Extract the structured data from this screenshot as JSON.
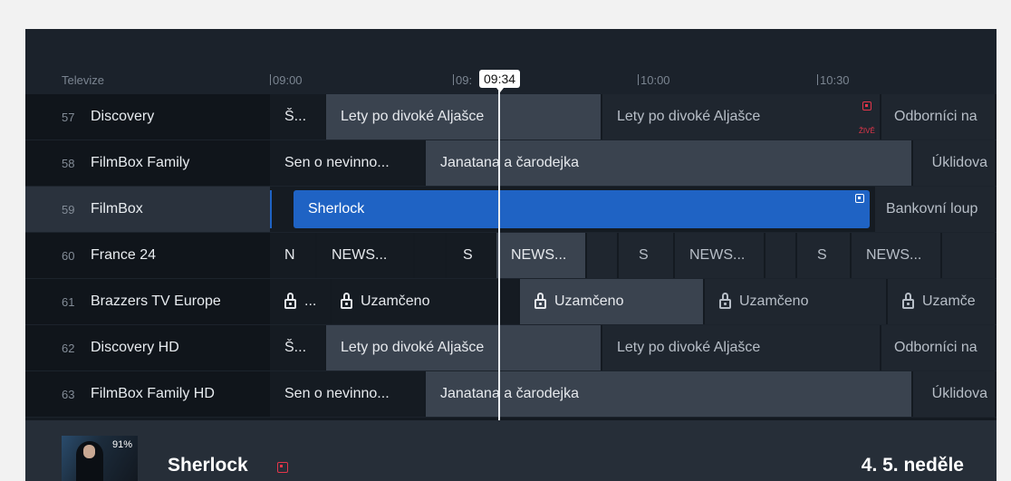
{
  "header": {
    "channels_label": "Televize",
    "times": [
      "09:00",
      "09:",
      "10:00",
      "10:30"
    ],
    "now_time": "09:34"
  },
  "rows": [
    {
      "num": "57",
      "name": "Discovery",
      "programs": [
        "Š...",
        "Lety po divoké Aljašce",
        "Lety po divoké Aljašce",
        "Odborníci na"
      ],
      "live_label": "ŽIVĚ"
    },
    {
      "num": "58",
      "name": "FilmBox Family",
      "programs": [
        "Sen o nevinno...",
        "Janatana a čarodejka",
        "Úklidova"
      ]
    },
    {
      "num": "59",
      "name": "FilmBox",
      "programs": [
        "Sherlock",
        "Bankovní loup"
      ]
    },
    {
      "num": "60",
      "name": "France 24",
      "programs": [
        "N",
        "NEWS...",
        "S",
        "NEWS...",
        "S",
        "NEWS...",
        "S",
        "NEWS..."
      ]
    },
    {
      "num": "61",
      "name": "Brazzers TV Europe",
      "programs": [
        "...",
        "Uzamčeno",
        "Uzamčeno",
        "Uzamčeno",
        "Uzamče"
      ]
    },
    {
      "num": "62",
      "name": "Discovery HD",
      "programs": [
        "Š...",
        "Lety po divoké Aljašce",
        "Lety po divoké Aljašce",
        "Odborníci na"
      ]
    },
    {
      "num": "63",
      "name": "FilmBox Family HD",
      "programs": [
        "Sen o nevinno...",
        "Janatana a čarodejka",
        "Úklidova"
      ]
    }
  ],
  "detail": {
    "progress_label": "91%",
    "title": "Sherlock",
    "date": "4. 5. neděle"
  },
  "colors": {
    "accent": "#1f63c4",
    "live": "#e3364a"
  }
}
